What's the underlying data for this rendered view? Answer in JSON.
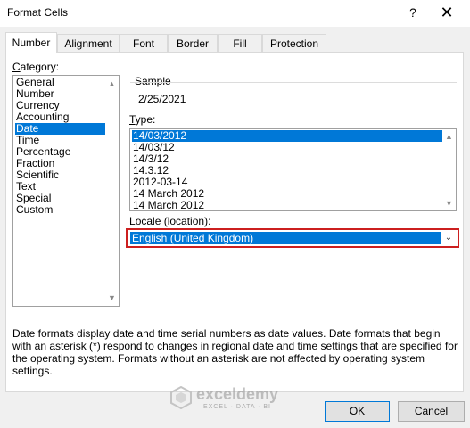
{
  "window": {
    "title": "Format Cells",
    "help_label": "?",
    "close_label": "✕"
  },
  "tabs": [
    {
      "label": "Number",
      "active": true
    },
    {
      "label": "Alignment"
    },
    {
      "label": "Font"
    },
    {
      "label": "Border"
    },
    {
      "label": "Fill"
    },
    {
      "label": "Protection"
    }
  ],
  "category": {
    "label_first": "C",
    "label_rest": "ategory:",
    "items": [
      "General",
      "Number",
      "Currency",
      "Accounting",
      "Date",
      "Time",
      "Percentage",
      "Fraction",
      "Scientific",
      "Text",
      "Special",
      "Custom"
    ],
    "selected": "Date"
  },
  "sample": {
    "label": "Sample",
    "value": "2/25/2021"
  },
  "type": {
    "label_first": "T",
    "label_rest": "ype:",
    "items": [
      "14/03/2012",
      "14/03/12",
      "14/3/12",
      "14.3.12",
      "2012-03-14",
      "14 March 2012",
      "14 March 2012"
    ],
    "selected": "14/03/2012"
  },
  "locale": {
    "label_first": "L",
    "label_rest": "ocale (location):",
    "value": "English (United Kingdom)"
  },
  "description": "Date formats display date and time serial numbers as date values.  Date formats that begin with an asterisk (*) respond to changes in regional date and time settings that are specified for the operating system. Formats without an asterisk are not affected by operating system settings.",
  "watermark": {
    "name": "exceldemy",
    "tagline": "EXCEL · DATA · BI"
  },
  "buttons": {
    "ok": "OK",
    "cancel": "Cancel"
  },
  "colors": {
    "selection": "#0078d7",
    "highlight_border": "#cc1f1f"
  }
}
